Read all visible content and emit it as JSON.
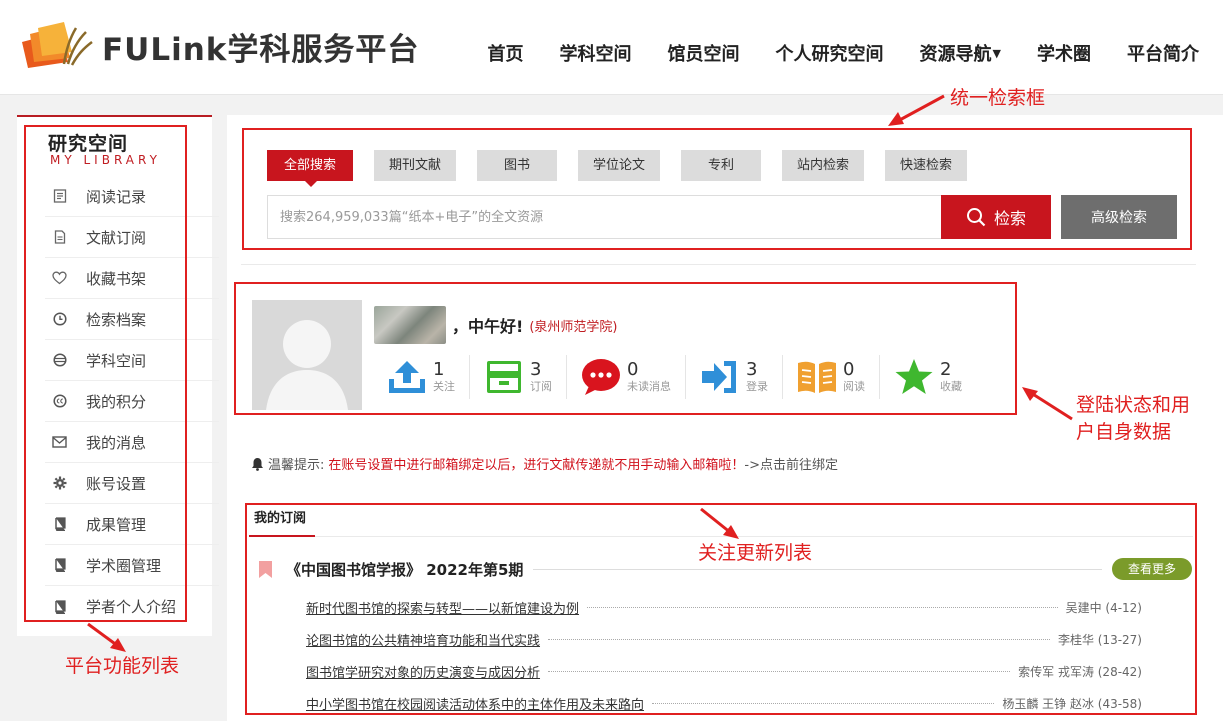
{
  "header": {
    "brand": "FULink学科服务平台",
    "nav": [
      {
        "label": "首页"
      },
      {
        "label": "学科空间"
      },
      {
        "label": "馆员空间"
      },
      {
        "label": "个人研究空间"
      },
      {
        "label": "资源导航",
        "caret": "▼"
      },
      {
        "label": "学术圈"
      },
      {
        "label": "平台简介"
      }
    ]
  },
  "sidebar": {
    "title": "研究空间",
    "subtitle": "MY LIBRARY",
    "items": [
      {
        "label": "阅读记录",
        "icon": "reading-record-icon"
      },
      {
        "label": "文献订阅",
        "icon": "document-icon"
      },
      {
        "label": "收藏书架",
        "icon": "heart-icon"
      },
      {
        "label": "检索档案",
        "icon": "clock-icon"
      },
      {
        "label": "学科空间",
        "icon": "globe-icon"
      },
      {
        "label": "我的积分",
        "icon": "points-icon"
      },
      {
        "label": "我的消息",
        "icon": "envelope-icon"
      },
      {
        "label": "账号设置",
        "icon": "gear-icon"
      },
      {
        "label": "成果管理",
        "icon": "book-icon"
      },
      {
        "label": "学术圈管理",
        "icon": "book-icon"
      },
      {
        "label": "学者个人介绍",
        "icon": "book-icon"
      }
    ]
  },
  "search": {
    "tabs": [
      "全部搜索",
      "期刊文献",
      "图书",
      "学位论文",
      "专利",
      "站内检索",
      "快速检索"
    ],
    "active_tab": "全部搜索",
    "placeholder": "搜索264,959,033篇“纸本+电子”的全文资源",
    "search_button": "检索",
    "advanced_button": "高级检索"
  },
  "user": {
    "greeting": "，中午好!",
    "school": "(泉州师范学院)",
    "stats": [
      {
        "value": "1",
        "label": "关注",
        "icon": "upload-icon",
        "color": "#2f8fd8"
      },
      {
        "value": "3",
        "label": "订阅",
        "icon": "inbox-icon",
        "color": "#3fb72f"
      },
      {
        "value": "0",
        "label": "未读消息",
        "icon": "message-icon",
        "color": "#d9141e"
      },
      {
        "value": "3",
        "label": "登录",
        "icon": "login-icon",
        "color": "#2f8fd8"
      },
      {
        "value": "0",
        "label": "阅读",
        "icon": "open-book-icon",
        "color": "#f0a030"
      },
      {
        "value": "2",
        "label": "收藏",
        "icon": "star-icon",
        "color": "#3fb72f"
      }
    ]
  },
  "notice": {
    "prefix": "温馨提示:",
    "message": "在账号设置中进行邮箱绑定以后，进行文献传递就不用手动输入邮箱啦！",
    "link": "->点击前往绑定"
  },
  "subscription": {
    "tab_label": "我的订阅",
    "journal": "《中国图书馆学报》 2022年第5期",
    "more_button": "查看更多",
    "articles": [
      {
        "title": "新时代图书馆的探索与转型——以新馆建设为例",
        "meta": "吴建中 (4-12)"
      },
      {
        "title": "论图书馆的公共精神培育功能和当代实践",
        "meta": "李桂华 (13-27)"
      },
      {
        "title": "图书馆学研究对象的历史演变与成因分析",
        "meta": "索传军 戎军涛 (28-42)"
      },
      {
        "title": "中小学图书馆在校园阅读活动体系中的主体作用及未来路向",
        "meta": "杨玉麟 王铮 赵冰 (43-58)"
      }
    ]
  },
  "annotations": {
    "search_label": "统一检索框",
    "user_label_line1": "登陆状态和用",
    "user_label_line2": "户自身数据",
    "list_label": "关注更新列表",
    "sidebar_label": "平台功能列表",
    "color": "#e02020"
  }
}
